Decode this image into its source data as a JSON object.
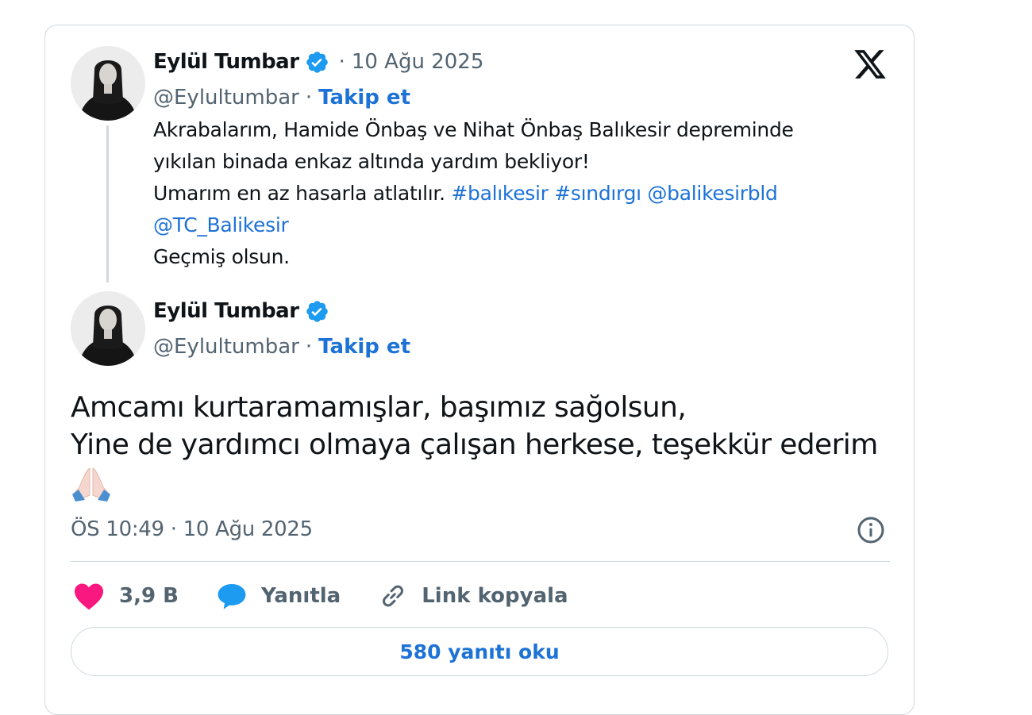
{
  "quoted_tweet": {
    "author_name": "Eylül Tumbar",
    "author_handle": "@Eylultumbar",
    "separator": "·",
    "date": "10 Ağu 2025",
    "follow_label": "Takip et",
    "lines": [
      [
        {
          "t": "Akrabalarım, Hamide Önbaş ve Nihat Önbaş Balıkesir depreminde"
        }
      ],
      [
        {
          "t": "yıkılan binada enkaz altında yardım bekliyor!"
        }
      ],
      [
        {
          "t": "Umarım en az hasarla atlatılır. "
        },
        {
          "t": "#balıkesir",
          "link": true
        },
        {
          "t": " "
        },
        {
          "t": "#sındırgı",
          "link": true
        },
        {
          "t": " "
        },
        {
          "t": "@balikesirbld",
          "link": true
        }
      ],
      [
        {
          "t": "@TC_Balikesir",
          "link": true
        }
      ],
      [
        {
          "t": "Geçmiş olsun."
        }
      ]
    ]
  },
  "main_tweet": {
    "author_name": "Eylül Tumbar",
    "author_handle": "@Eylultumbar",
    "separator": "·",
    "follow_label": "Takip et",
    "text_lines": [
      "Amcamı kurtaramamışlar, başımız sağolsun,",
      "Yine de yardımcı olmaya çalışan herkese, teşekkür ederim"
    ],
    "emoji_icon": "folded-hands-emoji",
    "timestamp": "ÖS 10:49 · 10 Ağu 2025"
  },
  "actions": {
    "like_count": "3,9 B",
    "reply_label": "Yanıtla",
    "copy_link_label": "Link kopyala"
  },
  "read_replies_label": "580 yanıtı oku",
  "colors": {
    "link": "#1d72d6",
    "muted": "#536471",
    "verified": "#1d9bf0",
    "like": "#f91880",
    "border": "#cfd9de"
  }
}
